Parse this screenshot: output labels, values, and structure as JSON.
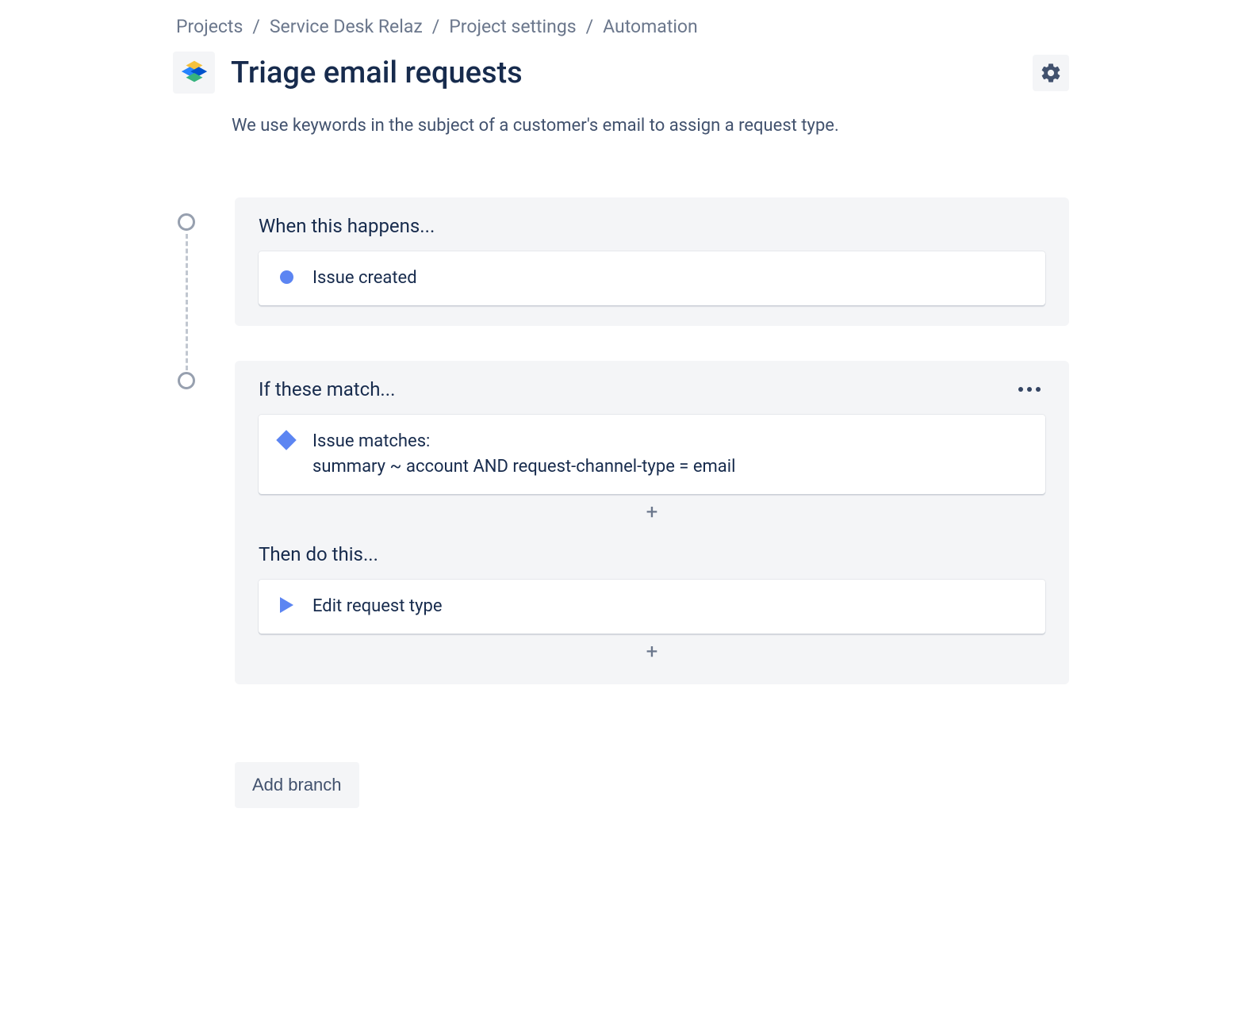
{
  "breadcrumbs": {
    "items": [
      "Projects",
      "Service Desk Relaz",
      "Project settings",
      "Automation"
    ],
    "sep": "/"
  },
  "rule": {
    "title": "Triage email requests",
    "description": "We use keywords in the subject of a customer's email to assign a request type."
  },
  "trigger": {
    "header": "When this happens...",
    "label": "Issue created"
  },
  "branch": {
    "header_if": "If these match...",
    "condition_label": "Issue matches:",
    "condition_jql": "summary ~ account AND request-channel-type = email",
    "header_then": "Then do this...",
    "action_label": "Edit request type",
    "plus": "+"
  },
  "actions": {
    "add_branch": "Add branch"
  }
}
